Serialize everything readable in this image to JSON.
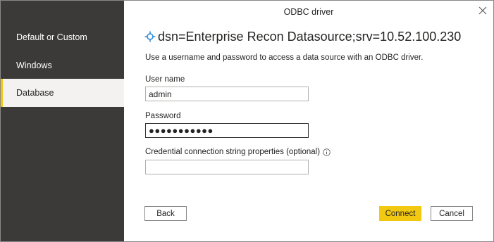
{
  "window": {
    "title": "ODBC driver"
  },
  "icons": {
    "close": "close-icon",
    "datasource": "datasource-icon",
    "info": "info-icon"
  },
  "colors": {
    "sidebar": "#3b3a39",
    "accent": "#f2c811",
    "selected_bg": "#f3f2f1"
  },
  "sidebar": {
    "items": [
      {
        "label": "Default or Custom",
        "selected": false
      },
      {
        "label": "Windows",
        "selected": false
      },
      {
        "label": "Database",
        "selected": true
      }
    ]
  },
  "main": {
    "heading": "dsn=Enterprise Recon Datasource;srv=10.52.100.230",
    "description": "Use a username and password to access a data source with an ODBC driver.",
    "username": {
      "label": "User name",
      "value": "admin"
    },
    "password": {
      "label": "Password",
      "value": "●●●●●●●●●●●"
    },
    "credential": {
      "label": "Credential connection string properties (optional)",
      "value": ""
    }
  },
  "buttons": {
    "back": "Back",
    "connect": "Connect",
    "cancel": "Cancel"
  }
}
